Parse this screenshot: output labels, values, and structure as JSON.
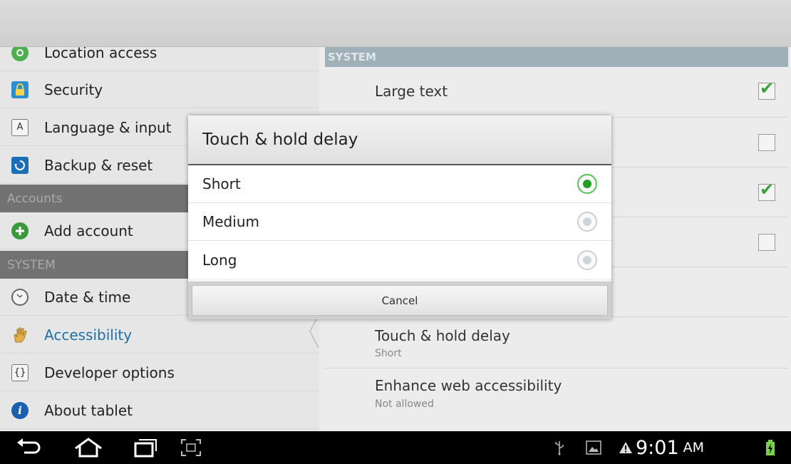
{
  "left_pane": {
    "items_top": [
      {
        "label": "Location access",
        "icon": "location-icon",
        "color": "#4caf50"
      },
      {
        "label": "Security",
        "icon": "lock-icon",
        "color": "#2a8fd0"
      },
      {
        "label": "Language & input",
        "icon": "keyboard-icon",
        "color": "#666666"
      },
      {
        "label": "Backup & reset",
        "icon": "backup-icon",
        "color": "#1a6fb8"
      }
    ],
    "accounts_header": "Accounts",
    "add_account": "Add account",
    "system_header": "SYSTEM",
    "items_bottom": [
      {
        "label": "Date & time",
        "icon": "clock-icon"
      },
      {
        "label": "Accessibility",
        "icon": "hand-icon",
        "selected": true
      },
      {
        "label": "Developer options",
        "icon": "braces-icon"
      },
      {
        "label": "About tablet",
        "icon": "info-icon"
      }
    ]
  },
  "right_pane": {
    "header": "SYSTEM",
    "large_text": "Large text",
    "touch_hold": {
      "title": "Touch & hold delay",
      "summary": "Short"
    },
    "enhance_web": {
      "title": "Enhance web accessibility",
      "summary": "Not allowed"
    },
    "checkboxes": [
      true,
      false,
      true,
      false
    ]
  },
  "dialog": {
    "title": "Touch & hold delay",
    "options": [
      {
        "label": "Short",
        "selected": true
      },
      {
        "label": "Medium",
        "selected": false
      },
      {
        "label": "Long",
        "selected": false
      }
    ],
    "cancel": "Cancel"
  },
  "status_bar": {
    "time": "9:01",
    "ampm": "AM"
  },
  "colors": {
    "accent": "#1f6fa8",
    "radio_selected": "#20a020",
    "check": "#3aa13a"
  }
}
